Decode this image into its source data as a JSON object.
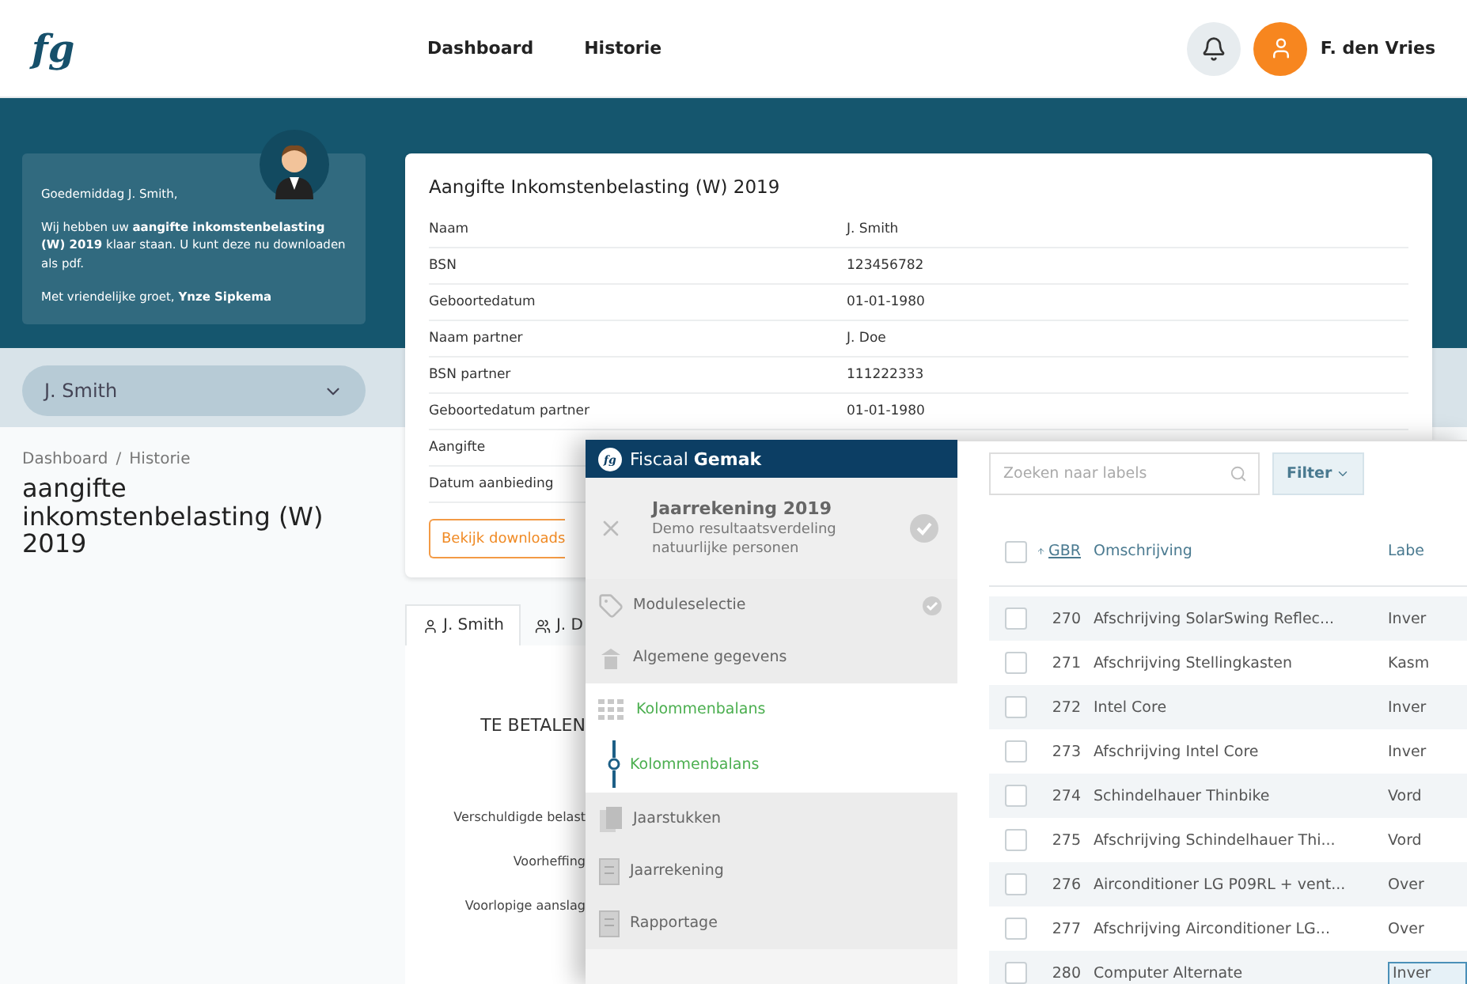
{
  "header": {
    "logo": "fg",
    "nav": [
      {
        "label": "Dashboard",
        "selected": false
      },
      {
        "label": "Historie",
        "selected": false
      }
    ],
    "user": "F. den Vries"
  },
  "greeting": {
    "salutation": "Goedemiddag J. Smith,",
    "message": "Wij hebben uw **aangifte inkomstenbelasting (W) 2019** klaar staan. U kunt deze nu downloaden als pdf.",
    "closing": "Met vriendelijke groet, **Ynze Sipkema**"
  },
  "person_select": {
    "value": "J. Smith"
  },
  "breadcrumb": {
    "items": [
      "Dashboard",
      "Historie"
    ],
    "separator": "/"
  },
  "page_title": "aangifte inkomstenbelasting (W) 2019",
  "summary": {
    "title": "Aangifte Inkomstenbelasting (W) 2019",
    "rows": [
      {
        "label": "Naam",
        "value": "J. Smith"
      },
      {
        "label": "BSN",
        "value": "123456782"
      },
      {
        "label": "Geboortedatum",
        "value": "01-01-1980"
      },
      {
        "label": "Naam partner",
        "value": "J. Doe"
      },
      {
        "label": "BSN partner",
        "value": "111222333"
      },
      {
        "label": "Geboortedatum partner",
        "value": "01-01-1980"
      },
      {
        "label": "Aangifte"
      },
      {
        "label": "Datum aanbieding"
      }
    ],
    "button": "Bekijk downloads"
  },
  "person_tabs": [
    {
      "label": "J. Smith",
      "kind": "single",
      "selected": true
    },
    {
      "label": "J. D",
      "kind": "couple",
      "selected": false
    }
  ],
  "payment": {
    "heading": "TE BETALEN",
    "lines": [
      "Verschuldigde belast",
      "Voorheffing",
      "Voorlopige aanslag"
    ]
  },
  "app": {
    "logo": "fg",
    "brand": "Fiscaal",
    "brand_bold": "Gemak",
    "project": {
      "title": "Jaarrekening 2019",
      "subtitle": "Demo resultaatsverdeling natuurlijke personen",
      "done": true
    },
    "nav": [
      {
        "label": "Moduleselectie",
        "done": true,
        "active": false,
        "kind": "item"
      },
      {
        "label": "Algemene gegevens",
        "done": false,
        "active": false,
        "kind": "item"
      },
      {
        "label": "Kolommenbalans",
        "done": false,
        "active": true,
        "kind": "item"
      },
      {
        "label": "Kolommenbalans",
        "done": false,
        "active": true,
        "kind": "step"
      },
      {
        "label": "Jaarstukken",
        "done": false,
        "active": false,
        "kind": "item"
      },
      {
        "label": "Jaarrekening",
        "done": false,
        "active": false,
        "kind": "item"
      },
      {
        "label": "Rapportage",
        "done": false,
        "active": false,
        "kind": "item"
      }
    ],
    "search": {
      "placeholder": "Zoeken naar labels"
    },
    "filter": "Filter",
    "table": {
      "select_all_checked": false,
      "columns": [
        {
          "label": "GBR",
          "sorted": true
        },
        {
          "label": "Omschrijving",
          "sorted": false
        },
        {
          "label": "Labe",
          "sorted": false
        }
      ],
      "rows": [
        {
          "gbr": "270",
          "description": "Afschrijving SolarSwing Reflec...",
          "label": "Inver",
          "checked": false,
          "highlighted": false
        },
        {
          "gbr": "271",
          "description": "Afschrijving Stellingkasten",
          "label": "Kasm",
          "checked": false,
          "highlighted": false
        },
        {
          "gbr": "272",
          "description": "Intel Core",
          "label": "Inver",
          "checked": false,
          "highlighted": false
        },
        {
          "gbr": "273",
          "description": "Afschrijving Intel Core",
          "label": "Inver",
          "checked": false,
          "highlighted": false
        },
        {
          "gbr": "274",
          "description": "Schindelhauer Thinbike",
          "label": "Vord",
          "checked": false,
          "highlighted": false
        },
        {
          "gbr": "275",
          "description": "Afschrijving Schindelhauer Thi...",
          "label": "Vord",
          "checked": false,
          "highlighted": false
        },
        {
          "gbr": "276",
          "description": "Airconditioner LG P09RL + vent...",
          "label": "Over",
          "checked": false,
          "highlighted": false
        },
        {
          "gbr": "277",
          "description": "Afschrijving Airconditioner LG...",
          "label": "Over",
          "checked": false,
          "highlighted": false
        },
        {
          "gbr": "280",
          "description": "Computer Alternate",
          "label": "Inver",
          "checked": false,
          "highlighted": true
        }
      ]
    }
  }
}
